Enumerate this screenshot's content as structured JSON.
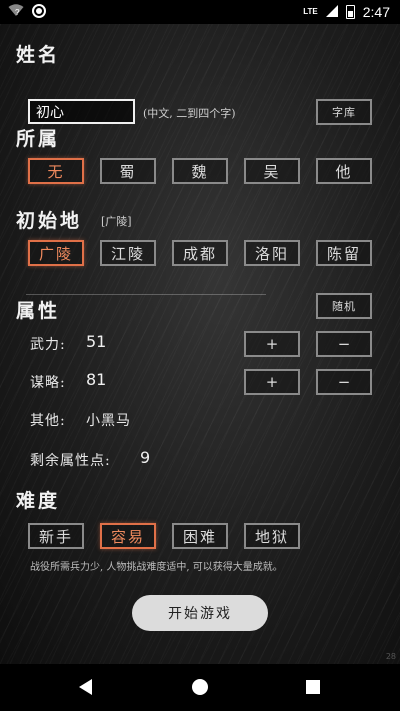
{
  "status": {
    "time": "2:47",
    "network": "LTE",
    "signal_badge": "?"
  },
  "name_section": {
    "title": "姓名",
    "value": "初心",
    "hint": "(中文, 二到四个字)",
    "library_button": "字库"
  },
  "faction_section": {
    "title": "所属",
    "options": [
      "无",
      "蜀",
      "魏",
      "吴",
      "他"
    ],
    "selected_index": 0
  },
  "origin_section": {
    "title": "初始地",
    "current": "[广陵]",
    "options": [
      "广陵",
      "江陵",
      "成都",
      "洛阳",
      "陈留"
    ],
    "selected_index": 0
  },
  "attributes": {
    "title": "属性",
    "random_button": "随机",
    "martial_label": "武力:",
    "martial_value": "51",
    "strategy_label": "谋略:",
    "strategy_value": "81",
    "other_label": "其他:",
    "other_value": "小黑马",
    "remaining_label": "剩余属性点:",
    "remaining_value": "9",
    "plus": "+",
    "minus": "−"
  },
  "difficulty": {
    "title": "难度",
    "options": [
      "新手",
      "容易",
      "困难",
      "地狱"
    ],
    "selected_index": 1,
    "description": "战役所需兵力少, 人物挑战难度适中, 可以获得大量成就。"
  },
  "start_button": "开始游戏",
  "fps": "28",
  "colors": {
    "accent": "#e07048",
    "border": "#8a8a8a"
  }
}
